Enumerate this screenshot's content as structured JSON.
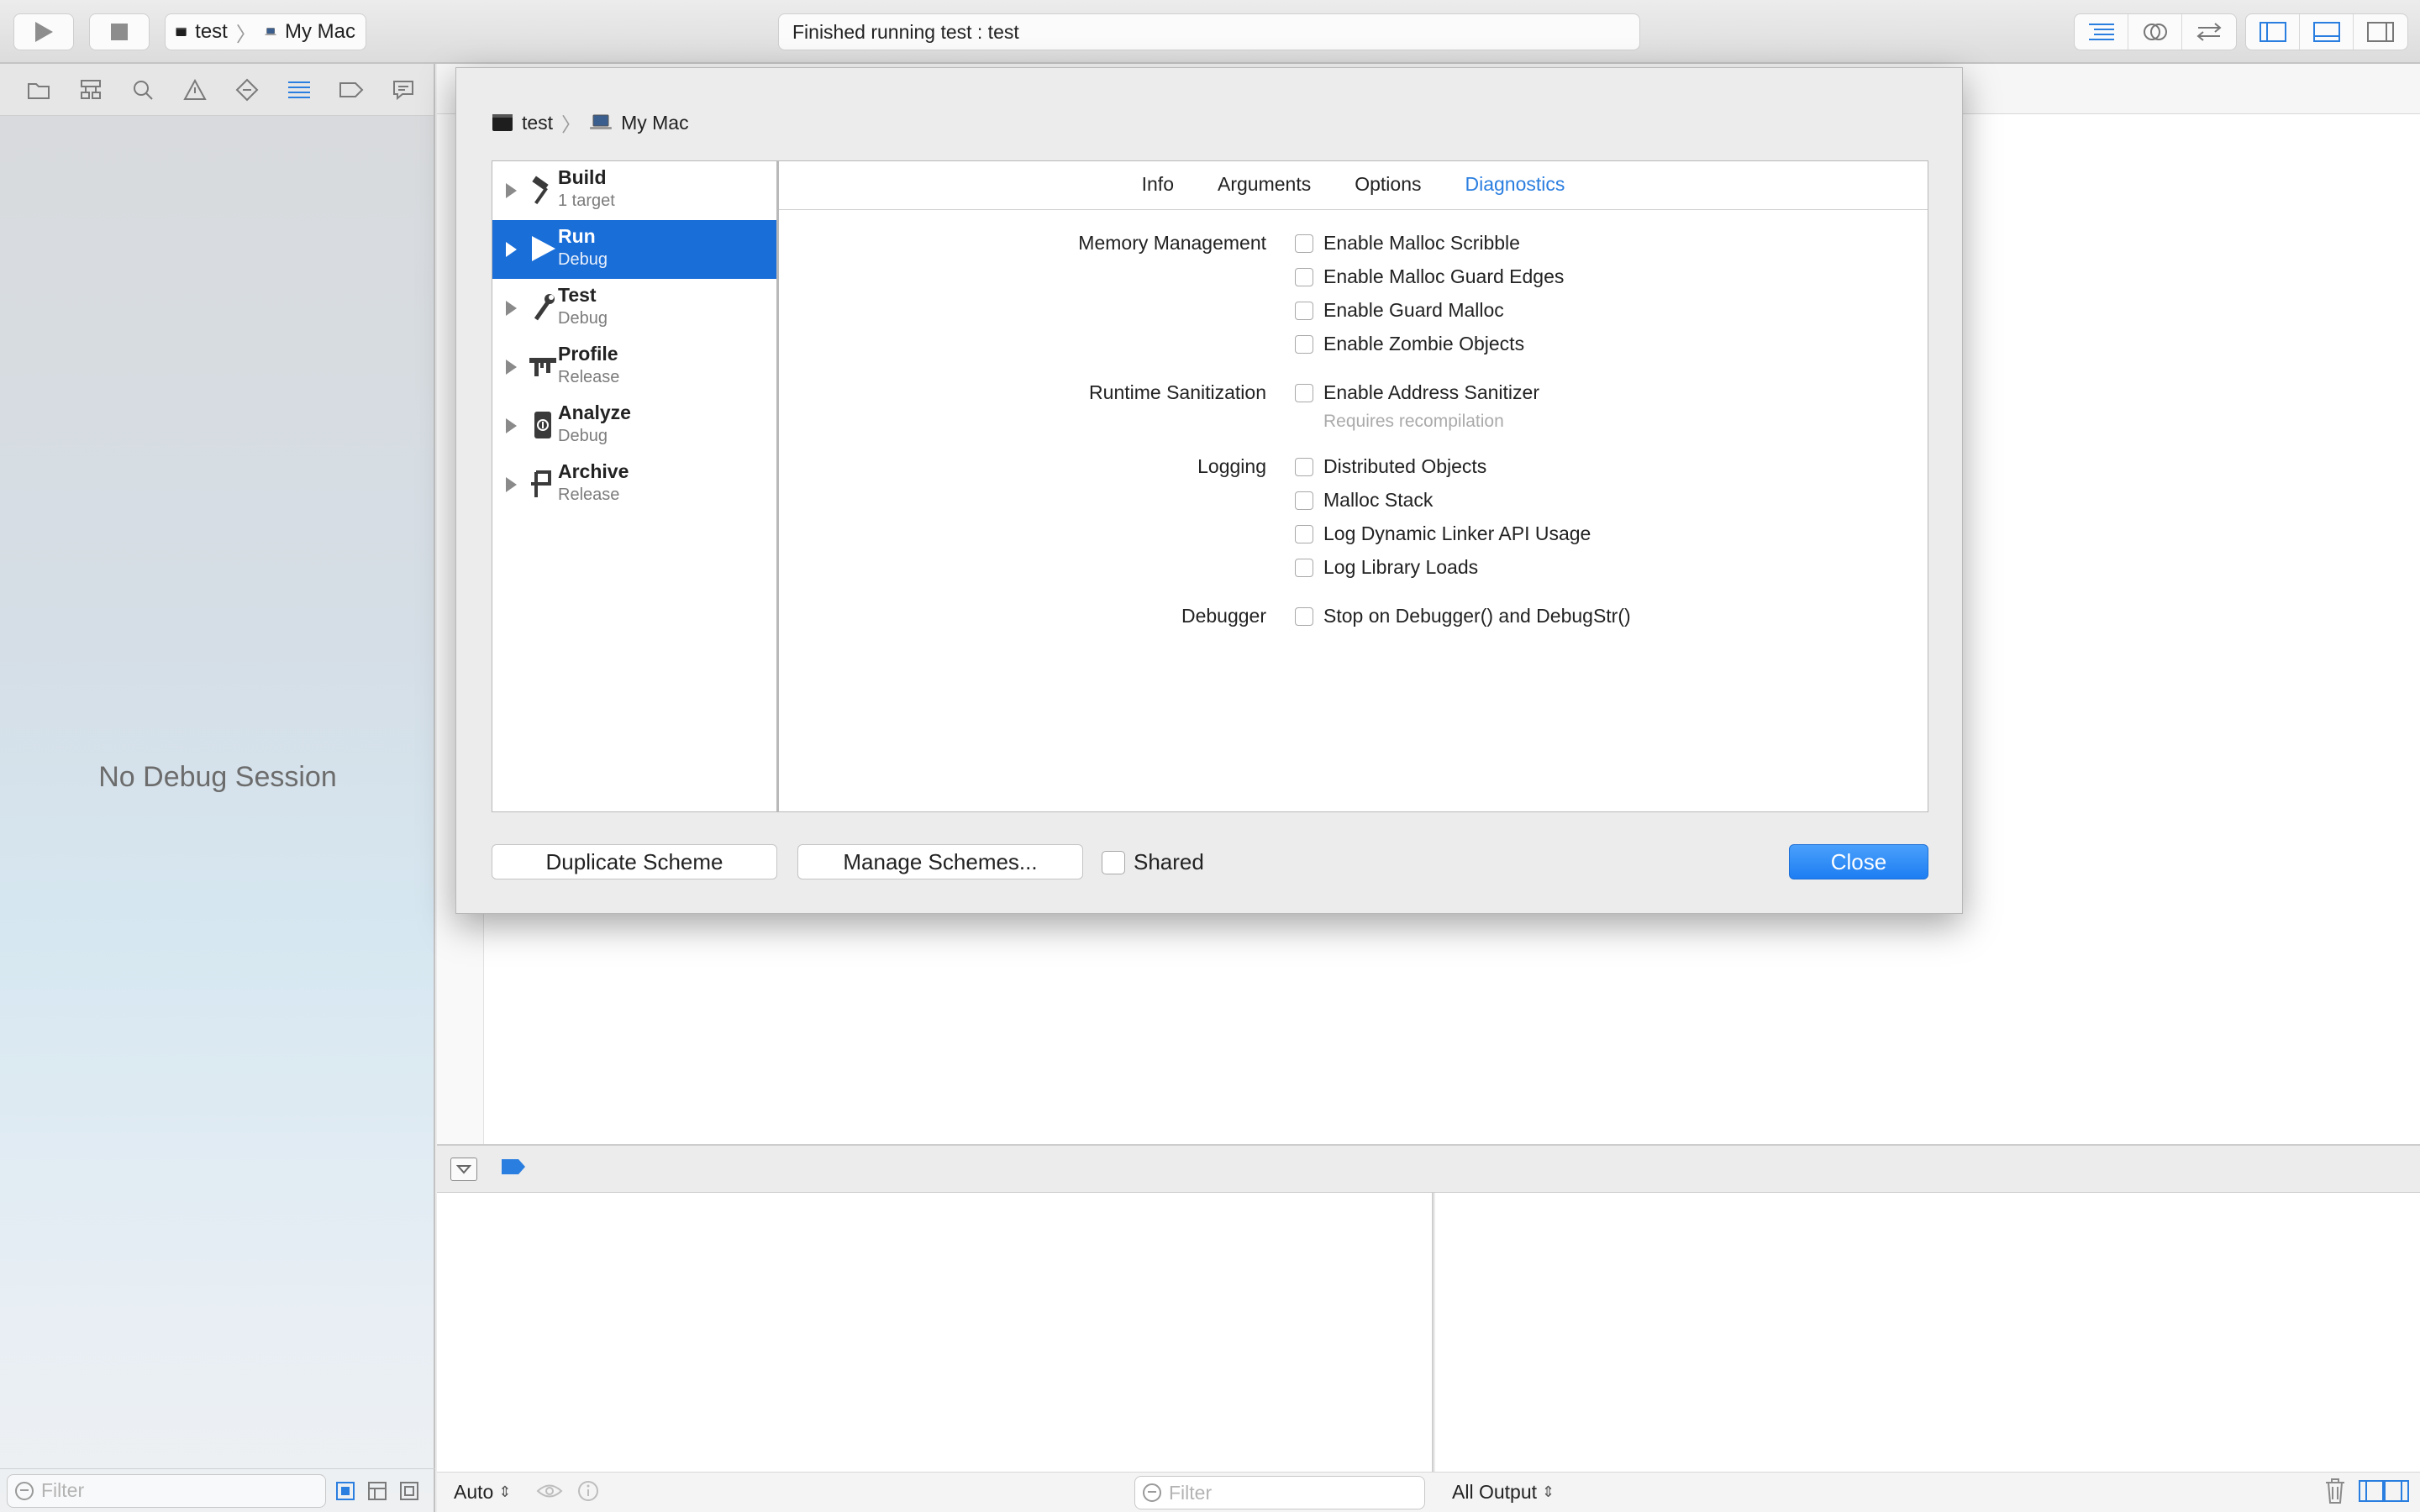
{
  "toolbar": {
    "scheme_name": "test",
    "destination": "My Mac",
    "activity_status": "Finished running test : test"
  },
  "navigator": {
    "empty_message": "No Debug Session",
    "filter_placeholder": "Filter"
  },
  "sheet": {
    "breadcrumb": {
      "scheme": "test",
      "destination": "My Mac"
    },
    "actions": [
      {
        "title": "Build",
        "subtitle": "1 target",
        "selected": false
      },
      {
        "title": "Run",
        "subtitle": "Debug",
        "selected": true
      },
      {
        "title": "Test",
        "subtitle": "Debug",
        "selected": false
      },
      {
        "title": "Profile",
        "subtitle": "Release",
        "selected": false
      },
      {
        "title": "Analyze",
        "subtitle": "Debug",
        "selected": false
      },
      {
        "title": "Archive",
        "subtitle": "Release",
        "selected": false
      }
    ],
    "tabs": [
      "Info",
      "Arguments",
      "Options",
      "Diagnostics"
    ],
    "active_tab": "Diagnostics",
    "sections": {
      "memory": {
        "label": "Memory Management",
        "options": [
          "Enable Malloc Scribble",
          "Enable Malloc Guard Edges",
          "Enable Guard Malloc",
          "Enable Zombie Objects"
        ]
      },
      "sanitization": {
        "label": "Runtime Sanitization",
        "options": [
          "Enable Address Sanitizer"
        ],
        "hint": "Requires recompilation"
      },
      "logging": {
        "label": "Logging",
        "options": [
          "Distributed Objects",
          "Malloc Stack",
          "Log Dynamic Linker API Usage",
          "Log Library Loads"
        ]
      },
      "debugger": {
        "label": "Debugger",
        "options": [
          "Stop on Debugger() and DebugStr()"
        ]
      }
    },
    "buttons": {
      "duplicate": "Duplicate Scheme",
      "manage": "Manage Schemes...",
      "shared": "Shared",
      "close": "Close"
    }
  },
  "debug_area": {
    "variables_mode": "Auto",
    "filter_placeholder": "Filter",
    "console_mode": "All Output"
  },
  "colors": {
    "accent": "#1a6ed8",
    "tab_active": "#2a7ee0",
    "close_button": "#1d7df2"
  }
}
